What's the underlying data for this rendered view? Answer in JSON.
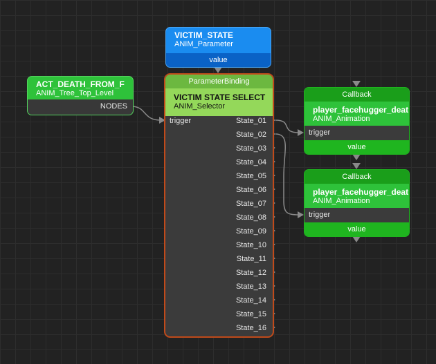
{
  "colors": {
    "canvas": "#222222",
    "param_blue": "#1a8cf0",
    "param_blue_dark": "#0a62c6",
    "tree_green": "#2ec23a",
    "selector_green_light": "#94d85a",
    "anim_green": "#1fb51f",
    "node_body": "#3b3b3b",
    "selector_border": "#c04a1a",
    "wire": "#8a8a8a"
  },
  "victim_state": {
    "title": "VICTIM_STATE",
    "subtitle": "ANIM_Parameter",
    "output": "value"
  },
  "act_death": {
    "title": "ACT_DEATH_FROM_F",
    "subtitle": "ANIM_Tree_Top_Level",
    "output": "NODES"
  },
  "selector": {
    "binding_label": "ParameterBinding",
    "title": "VICTIM STATE SELECT",
    "subtitle": "ANIM_Selector",
    "input": "trigger",
    "states": [
      "State_01",
      "State_02",
      "State_03",
      "State_04",
      "State_05",
      "State_06",
      "State_07",
      "State_08",
      "State_09",
      "State_10",
      "State_11",
      "State_12",
      "State_13",
      "State_14",
      "State_15",
      "State_16"
    ]
  },
  "callbacks": [
    {
      "label": "Callback",
      "title": "player_facehugger_deat",
      "subtitle": "ANIM_Animation",
      "input": "trigger",
      "output": "value"
    },
    {
      "label": "Callback",
      "title": "player_facehugger_deat",
      "subtitle": "ANIM_Animation",
      "input": "trigger",
      "output": "value"
    }
  ]
}
